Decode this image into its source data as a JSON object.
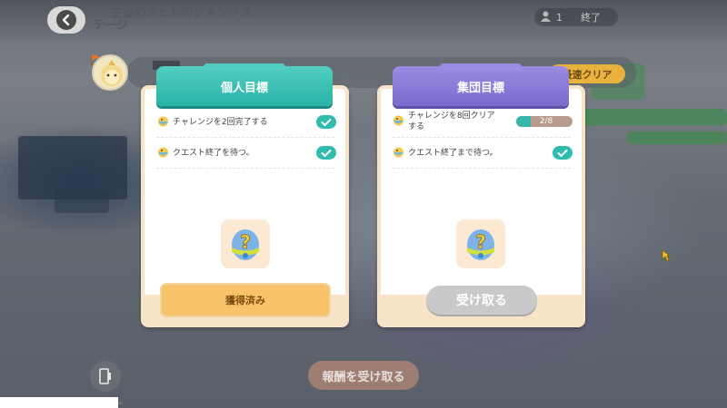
{
  "header": {
    "back_icon": "chevron-left-icon",
    "title_line1": "主催のアヒルのジャンプス",
    "title_line2": "テージ",
    "player_count": "1",
    "status_label": "終了"
  },
  "fast_clear_badge": "最速クリア",
  "personal_panel": {
    "title": "個人目標",
    "tasks": [
      {
        "label": "チャレンジを2回完了する",
        "completed": true
      },
      {
        "label": "クエスト終了を待つ。",
        "completed": true
      }
    ],
    "reward_icon": "mystery-egg-icon",
    "button_label": "獲得済み"
  },
  "group_panel": {
    "title": "集団目標",
    "tasks": [
      {
        "label_line1": "チャレンジを8回クリア",
        "label_line2": "する",
        "progress_text": "2/8",
        "progress": 0.25
      },
      {
        "label": "クエスト終了まで待つ。",
        "completed": true
      }
    ],
    "reward_icon": "mystery-egg-icon",
    "button_label": "受け取る"
  },
  "claim_all_button": "報酬を受け取る",
  "colors": {
    "personal_accent": "#2ab3a8",
    "group_accent": "#7a6bcc",
    "claimed_button": "#f8c26a",
    "fast_badge": "#e9b23f"
  }
}
